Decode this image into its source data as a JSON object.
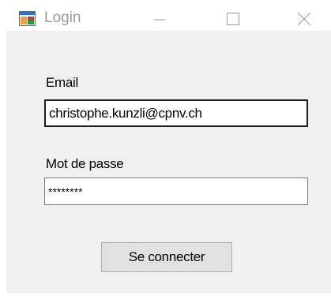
{
  "window": {
    "title": "Login",
    "icon": "windows-form-icon",
    "controls": {
      "minimize": "minimize-icon",
      "maximize": "maximize-icon",
      "close": "close-icon"
    }
  },
  "form": {
    "email_label": "Email",
    "email_value": "christophe.kunzli@cpnv.ch",
    "password_label": "Mot de passe",
    "password_value": "********",
    "connect_button": "Se connecter"
  },
  "colors": {
    "client_background": "#f0f0f0",
    "button_background": "#e1e1e1"
  }
}
